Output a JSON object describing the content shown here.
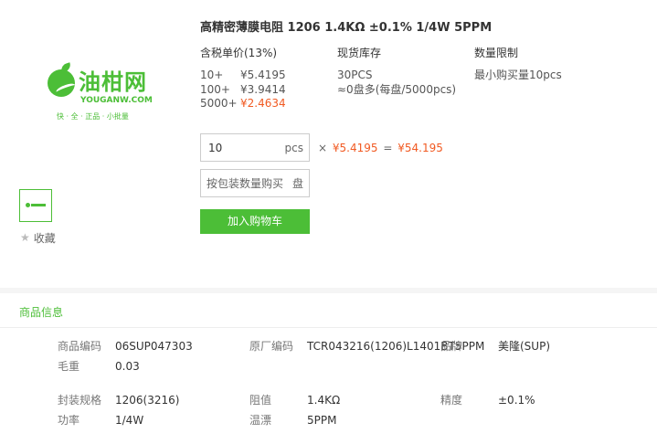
{
  "logo": {
    "name_cn": "油柑网",
    "name_en": "YOUGANW.COM",
    "slogan": "快 · 全 · 正品 · 小批量"
  },
  "favorite": {
    "label": "收藏",
    "icon": "star-icon"
  },
  "product": {
    "title": "高精密薄膜电阻 1206 1.4KΩ ±0.1% 1/4W 5PPM"
  },
  "pricing": {
    "header": "含税单价(13%)",
    "tiers": [
      {
        "qty": "10+",
        "price": "¥5.4195",
        "highlight": false
      },
      {
        "qty": "100+",
        "price": "¥3.9414",
        "highlight": false
      },
      {
        "qty": "5000+",
        "price": "¥2.4634",
        "highlight": true
      }
    ]
  },
  "stock": {
    "header": "现货库存",
    "count": "30PCS",
    "reel": "≈0盘多(每盘/5000pcs)"
  },
  "limit": {
    "header": "数量限制",
    "text": "最小购买量10pcs"
  },
  "order": {
    "quantity": "10",
    "quantity_unit": "pcs",
    "times": "×",
    "unit_price": "¥5.4195",
    "equals": "=",
    "total": "¥54.195",
    "pack_placeholder": "按包装数量购买",
    "pack_unit": "盘",
    "cart_button": "加入购物车"
  },
  "colors": {
    "accent": "#4cbe37",
    "price_highlight": "#f15a22"
  },
  "info": {
    "title": "商品信息",
    "fields": {
      "code_label": "商品编码",
      "code_value": "06SUP047303",
      "mfr_code_label": "原厂编码",
      "mfr_code_value": "TCR043216(1206)L1401BT5PPM",
      "brand_label": "品牌",
      "brand_value": "美隆(SUP)",
      "weight_label": "毛重",
      "weight_value": "0.03",
      "package_label": "封装规格",
      "package_value": "1206(3216)",
      "resistance_label": "阻值",
      "resistance_value": "1.4KΩ",
      "accuracy_label": "精度",
      "accuracy_value": "±0.1%",
      "power_label": "功率",
      "power_value": "1/4W",
      "tempco_label": "温漂",
      "tempco_value": "5PPM"
    }
  }
}
